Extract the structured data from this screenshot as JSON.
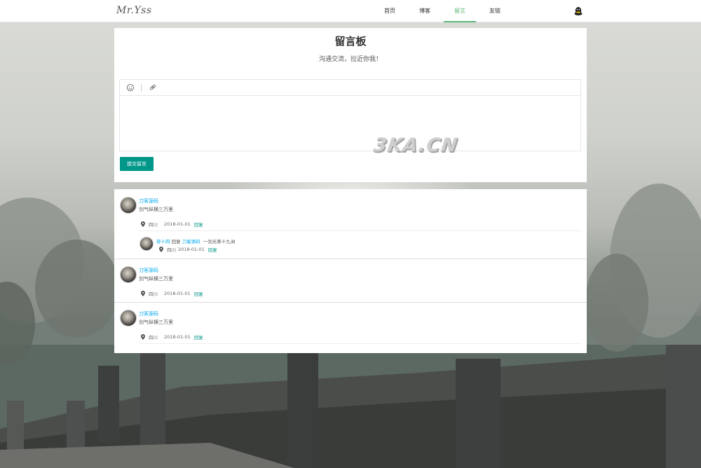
{
  "header": {
    "logo": "Mr.Yss",
    "nav": [
      {
        "label": "首页",
        "active": false
      },
      {
        "label": "博客",
        "active": false
      },
      {
        "label": "留言",
        "active": true
      },
      {
        "label": "友链",
        "active": false
      }
    ],
    "right_icon": "qq-icon"
  },
  "board": {
    "title": "留言板",
    "subtitle": "沟通交流，拉近你我！",
    "toolbar": [
      "emoji-icon",
      "link-icon"
    ],
    "editor_value": "",
    "submit_label": "提交留言",
    "watermark": "3KA.CN"
  },
  "colors": {
    "accent": "#009688",
    "nav_active": "#5fb878",
    "link": "#01aaed"
  },
  "comments": [
    {
      "name": "刀客源码",
      "text": "剑气纵横三万里",
      "location": "四川",
      "date": "2018-01-01",
      "reply_label": "回复",
      "replies": [
        {
          "name": "奔十四",
          "reply_word": "回复",
          "target": "刀客源码",
          "text": "一剑光寒十九洲",
          "location": "四川",
          "date": "2018-01-01",
          "reply_label": "回复"
        }
      ]
    },
    {
      "name": "刀客源码",
      "text": "剑气纵横三万里",
      "location": "四川",
      "date": "2018-01-01",
      "reply_label": "回复"
    },
    {
      "name": "刀客源码",
      "text": "剑气纵横三万里",
      "location": "四川",
      "date": "2018-01-01",
      "reply_label": "回复"
    }
  ]
}
